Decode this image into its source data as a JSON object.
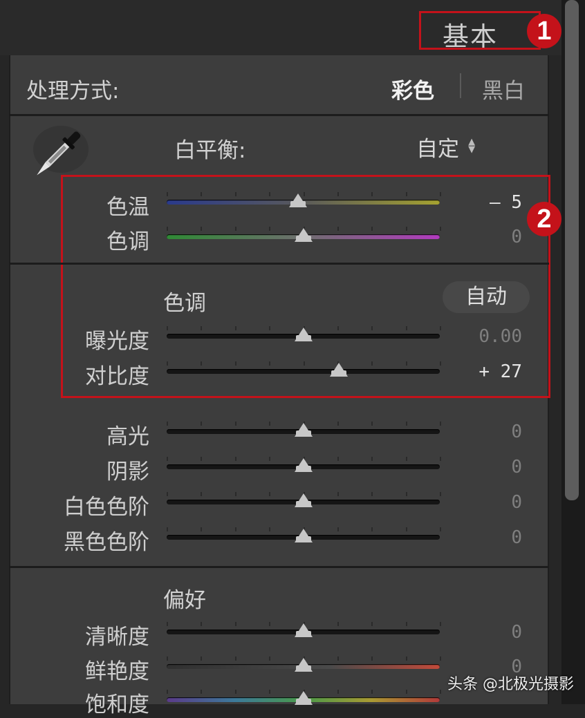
{
  "panel": {
    "title": "基本"
  },
  "badges": {
    "first": "1",
    "second": "2"
  },
  "treatment": {
    "label": "处理方式:",
    "color_option": "彩色",
    "bw_option": "黑白"
  },
  "white_balance": {
    "label": "白平衡:",
    "preset": "自定"
  },
  "sliders_wb": [
    {
      "label": "色温",
      "value": "– 5",
      "position": 0.48
    },
    {
      "label": "色调",
      "value": "0",
      "position": 0.5
    }
  ],
  "tone": {
    "heading": "色调",
    "auto_button": "自动"
  },
  "sliders_tone": [
    {
      "label": "曝光度",
      "value": "0.00",
      "position": 0.5
    },
    {
      "label": "对比度",
      "value": "+ 27",
      "position": 0.63
    }
  ],
  "sliders_light": [
    {
      "label": "高光",
      "value": "0",
      "position": 0.5
    },
    {
      "label": "阴影",
      "value": "0",
      "position": 0.5
    },
    {
      "label": "白色色阶",
      "value": "0",
      "position": 0.5
    },
    {
      "label": "黑色色阶",
      "value": "0",
      "position": 0.5
    }
  ],
  "presence": {
    "heading": "偏好"
  },
  "sliders_presence": [
    {
      "label": "清晰度",
      "value": "0",
      "position": 0.5
    },
    {
      "label": "鲜艳度",
      "value": "0",
      "position": 0.5
    },
    {
      "label": "饱和度",
      "value": "",
      "position": 0.5
    }
  ],
  "watermark": "头条 @北极光摄影",
  "colors": {
    "accent_red": "#c4121a",
    "panel_bg": "#3d3d3d"
  }
}
